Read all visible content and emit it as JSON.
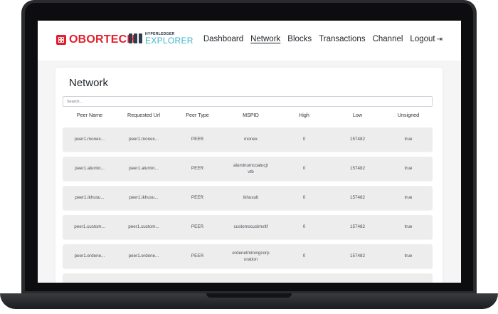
{
  "brand": {
    "name": "OBORTECH"
  },
  "explorer_logo": {
    "top": "HYPERLEDGER",
    "bottom": "EXPLORER"
  },
  "nav": {
    "items": [
      {
        "label": "Dashboard",
        "active": false
      },
      {
        "label": "Network",
        "active": true
      },
      {
        "label": "Blocks",
        "active": false
      },
      {
        "label": "Transactions",
        "active": false
      },
      {
        "label": "Channel",
        "active": false
      },
      {
        "label": "Logout",
        "active": false
      }
    ]
  },
  "page": {
    "title": "Network"
  },
  "search": {
    "placeholder": "Search..."
  },
  "table": {
    "headers": [
      "Peer Name",
      "Requested Url",
      "Peer Type",
      "MSPID",
      "High",
      "Low",
      "Unsigned"
    ],
    "rows": [
      [
        "peer1.monex...",
        "peer1.monex...",
        "PEER",
        "monex",
        "0",
        "157482",
        "true"
      ],
      [
        "peer1.alumin...",
        "peer1.alumin...",
        "PEER",
        "aluminumcoalucjrvtb",
        "0",
        "157482",
        "true"
      ],
      [
        "peer1.ikhusu...",
        "peer1.ikhusu...",
        "PEER",
        "ikhusult",
        "0",
        "157482",
        "true"
      ],
      [
        "peer1.custom...",
        "peer1.custom...",
        "PEER",
        "customscuslmxltf",
        "0",
        "157482",
        "true"
      ],
      [
        "peer1.erdene...",
        "peer1.erdene...",
        "PEER",
        "erdenetminingcorporation",
        "0",
        "157482",
        "true"
      ]
    ]
  },
  "colors": {
    "brand_red": "#e31e2d",
    "explorer_teal": "#3bb3c9",
    "row_bg": "#ededee"
  },
  "icons": {
    "logout": "logout-arrow-icon"
  }
}
